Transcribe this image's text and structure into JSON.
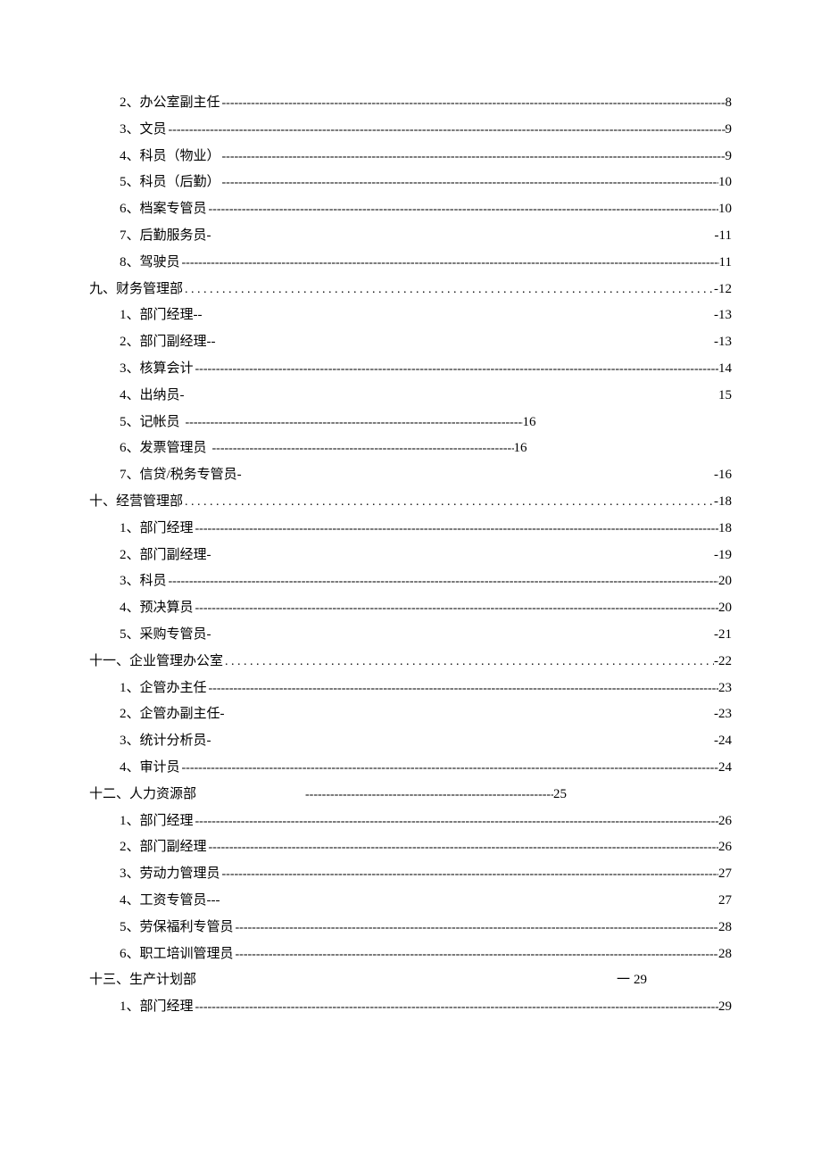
{
  "toc": {
    "items": [
      {
        "type": "sub",
        "label": "2、办公室副主任",
        "leader": "dashes",
        "page": "8"
      },
      {
        "type": "sub",
        "label": "3、文员",
        "leader": "dashes",
        "page": "9"
      },
      {
        "type": "sub",
        "label": "4、科员（物业）",
        "leader": "dashes",
        "page": "9"
      },
      {
        "type": "sub",
        "label": "5、科员（后勤）",
        "leader": "dashes",
        "page": "10"
      },
      {
        "type": "sub",
        "label": "6、档案专管员",
        "leader": "dashes",
        "page": "10"
      },
      {
        "type": "sub",
        "label": "7、后勤服务员-",
        "leader": "blank",
        "page": "-11"
      },
      {
        "type": "sub",
        "label": "8、驾驶员",
        "leader": "dashes",
        "page": "11"
      },
      {
        "type": "section",
        "label": "九、财务管理部",
        "leader": "dots",
        "page": "-12"
      },
      {
        "type": "sub",
        "label": "1、部门经理--",
        "leader": "blank",
        "page": "-13"
      },
      {
        "type": "sub",
        "label": "2、部门副经理--",
        "leader": "blank",
        "page": "-13"
      },
      {
        "type": "sub",
        "label": "3、核算会计",
        "leader": "dashes",
        "page": "14"
      },
      {
        "type": "sub",
        "label": "4、出纳员-",
        "leader": "blank",
        "page": "15"
      },
      {
        "type": "sub",
        "label": "5、记帐员",
        "leader": "dashes",
        "page": "16",
        "variant": "short"
      },
      {
        "type": "sub",
        "label": "6、发票管理员",
        "leader": "dashes",
        "page": "16",
        "variant": "short2"
      },
      {
        "type": "sub",
        "label": "7、信贷/税务专管员-",
        "leader": "blank",
        "page": "-16"
      },
      {
        "type": "section",
        "label": "十、经营管理部",
        "leader": "dots",
        "page": "-18"
      },
      {
        "type": "sub",
        "label": "1、部门经理",
        "leader": "dashes",
        "page": "18"
      },
      {
        "type": "sub",
        "label": "2、部门副经理-",
        "leader": "blank",
        "page": "-19"
      },
      {
        "type": "sub",
        "label": "3、科员",
        "leader": "dashes",
        "page": "20"
      },
      {
        "type": "sub",
        "label": "4、预决算员",
        "leader": "dashes",
        "page": "20"
      },
      {
        "type": "sub",
        "label": "5、采购专管员-",
        "leader": "blank",
        "page": "-21"
      },
      {
        "type": "section",
        "label": "十一、企业管理办公室",
        "leader": "dots",
        "page": "-22"
      },
      {
        "type": "sub",
        "label": "1、企管办主任",
        "leader": "dashes",
        "page": "23"
      },
      {
        "type": "sub",
        "label": "2、企管办副主任-",
        "leader": "blank",
        "page": "-23"
      },
      {
        "type": "sub",
        "label": "3、统计分析员-",
        "leader": "blank",
        "page": "-24"
      },
      {
        "type": "sub",
        "label": "4、审计员",
        "leader": "dashes",
        "page": "24"
      },
      {
        "type": "section",
        "label": "十二、人力资源部",
        "leader": "dashes",
        "page": "25",
        "variant": "short3",
        "leadpad": true
      },
      {
        "type": "sub",
        "label": "1、部门经理",
        "leader": "dashes",
        "page": "26"
      },
      {
        "type": "sub",
        "label": "2、部门副经理",
        "leader": "dashes",
        "page": "26"
      },
      {
        "type": "sub",
        "label": "3、劳动力管理员",
        "leader": "dashes",
        "page": "27"
      },
      {
        "type": "sub",
        "label": "4、工资专管员---",
        "leader": "blank",
        "page": "27"
      },
      {
        "type": "sub",
        "label": "5、劳保福利专管员",
        "leader": "dashes",
        "page": "28"
      },
      {
        "type": "sub",
        "label": "6、职工培训管理员",
        "leader": "dashes",
        "page": "28"
      },
      {
        "type": "section",
        "label": "十三、生产计划部",
        "leader": "blank",
        "page": "29",
        "variant": "section13",
        "prefix": "一"
      },
      {
        "type": "sub",
        "label": "1、部门经理",
        "leader": "dashes",
        "page": "29"
      }
    ]
  }
}
